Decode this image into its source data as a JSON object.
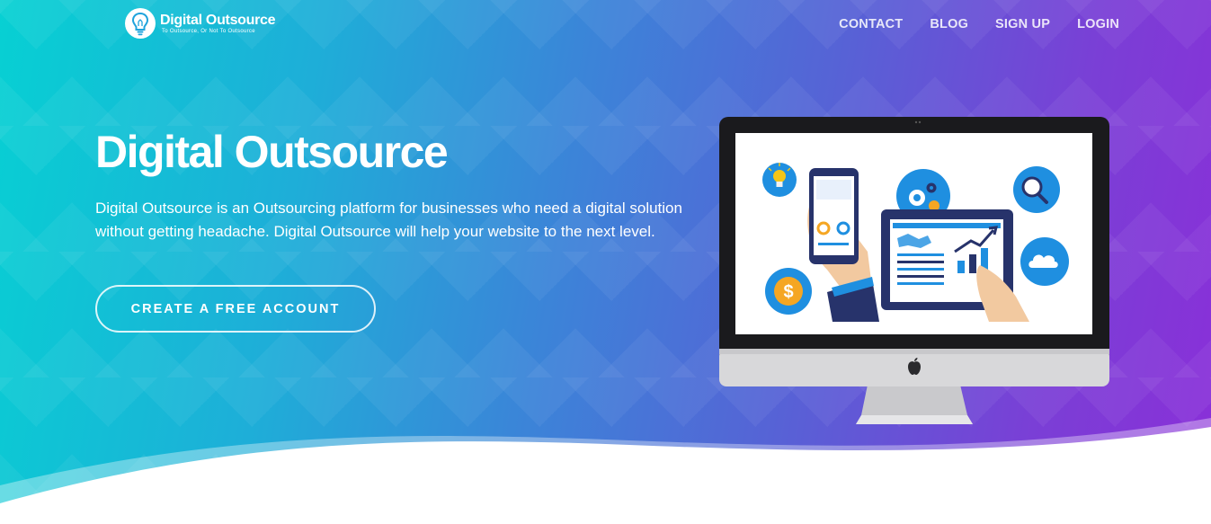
{
  "header": {
    "logo_title": "Digital Outsource",
    "logo_tagline": "To Outsource, Or Not To Outsource",
    "nav": [
      {
        "label": "CONTACT"
      },
      {
        "label": "BLOG"
      },
      {
        "label": "SIGN UP"
      },
      {
        "label": "LOGIN"
      }
    ]
  },
  "hero": {
    "title": "Digital Outsource",
    "description": "Digital Outsource is an Outsourcing platform for businesses who need a digital solution without getting headache. Digital Outsource will help your website to the next level.",
    "cta_label": "CREATE A FREE ACCOUNT"
  },
  "illustration": {
    "icons": [
      "lightbulb-icon",
      "gear-icon",
      "search-icon",
      "cloud-icon",
      "dollar-icon",
      "apple-logo-icon"
    ]
  },
  "colors": {
    "gradient_start": "#07d0d3",
    "gradient_end": "#8a2fd8",
    "icon_blue": "#1f8fe0",
    "navy": "#27336b"
  }
}
